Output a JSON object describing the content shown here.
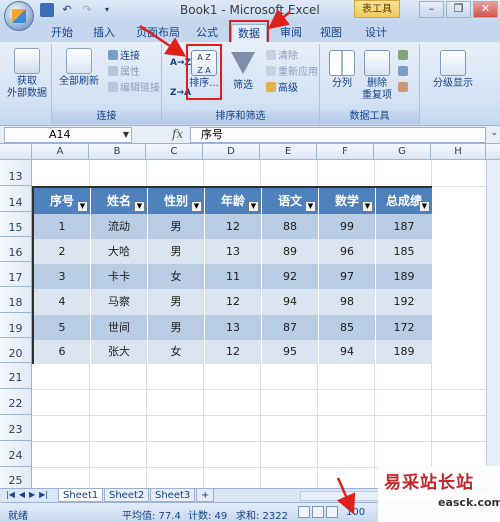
{
  "window": {
    "title": "Book1 - Microsoft Excel",
    "context_tab": "表工具"
  },
  "tabs": [
    {
      "label": "开始"
    },
    {
      "label": "插入"
    },
    {
      "label": "页面布局"
    },
    {
      "label": "公式"
    },
    {
      "label": "数据"
    },
    {
      "label": "审阅"
    },
    {
      "label": "视图"
    },
    {
      "label": "设计"
    }
  ],
  "ribbon": {
    "get_external": {
      "label1": "获取",
      "label2": "外部数据"
    },
    "refresh_all": {
      "label": "全部刷新"
    },
    "connections": {
      "label": "连接"
    },
    "properties": {
      "label": "属性"
    },
    "edit_links": {
      "label": "编辑链接"
    },
    "group_connections": "连接",
    "sort_az": "A→Z",
    "sort_za": "Z→A",
    "sort": {
      "label": "排序..."
    },
    "filter": {
      "label": "筛选"
    },
    "clear": {
      "label": "清除"
    },
    "reapply": {
      "label": "重新应用"
    },
    "advanced": {
      "label": "高级"
    },
    "group_sort_filter": "排序和筛选",
    "text_to_columns": {
      "label": "分列"
    },
    "remove_duplicates": {
      "label1": "删除",
      "label2": "重复项"
    },
    "group_data_tools": "数据工具",
    "outline": {
      "label": "分级显示"
    }
  },
  "formula_bar": {
    "name_box": "A14",
    "fx": "fx",
    "value": "序号"
  },
  "grid": {
    "columns": [
      "A",
      "B",
      "C",
      "D",
      "E",
      "F",
      "G",
      "H"
    ],
    "rows": [
      "13",
      "14",
      "15",
      "16",
      "17",
      "18",
      "19",
      "20",
      "21",
      "22",
      "23",
      "24",
      "25"
    ]
  },
  "table": {
    "headers": [
      "序号",
      "姓名",
      "性别",
      "年龄",
      "语文",
      "数学",
      "总成绩"
    ],
    "rows": [
      [
        "1",
        "流动",
        "男",
        "12",
        "88",
        "99",
        "187"
      ],
      [
        "2",
        "大哈",
        "男",
        "13",
        "89",
        "96",
        "185"
      ],
      [
        "3",
        "卡卡",
        "女",
        "11",
        "92",
        "97",
        "189"
      ],
      [
        "4",
        "马察",
        "男",
        "12",
        "94",
        "98",
        "192"
      ],
      [
        "5",
        "世间",
        "男",
        "13",
        "87",
        "85",
        "172"
      ],
      [
        "6",
        "张大",
        "女",
        "12",
        "95",
        "94",
        "189"
      ]
    ],
    "header_color": "#4f81bd",
    "band_dark": "#b8cce4",
    "band_light": "#dbe5f1"
  },
  "sheets": [
    {
      "label": "Sheet1"
    },
    {
      "label": "Sheet2"
    },
    {
      "label": "Sheet3"
    }
  ],
  "status": {
    "ready": "就绪",
    "average": "平均值: 77.4",
    "count": "计数: 49",
    "sum": "求和: 2322",
    "zoom": "100"
  },
  "watermark": {
    "main": "易采站长站",
    "sub": "easck.com"
  },
  "colors": {
    "highlight_red": "#e0201b",
    "ribbon_text": "#15428b"
  }
}
